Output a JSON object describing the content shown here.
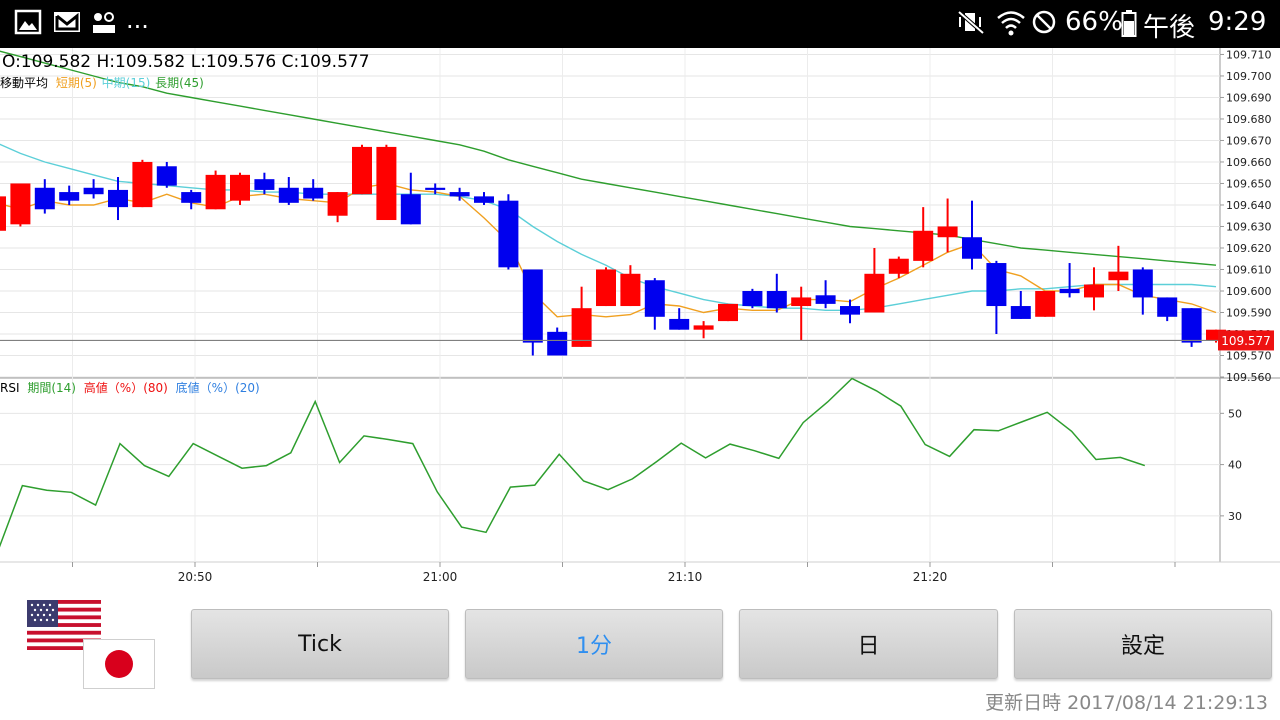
{
  "status_bar": {
    "icons": [
      "gallery-icon",
      "gmail-icon",
      "voicemail-icon",
      "more-notifications-icon",
      "mute-vibrate-icon",
      "wifi-icon",
      "do-not-disturb-icon",
      "battery-icon"
    ],
    "more_label": "...",
    "battery_pct": "66%",
    "ampm": "午後",
    "time": "9:29"
  },
  "chart": {
    "ohlc": {
      "text": "O:109.582 H:109.582 L:109.576 C:109.577"
    },
    "ma_legend": {
      "title": "移動平均",
      "short": "短期(5)",
      "mid": "中期(15)",
      "long": "長期(45)"
    },
    "colors": {
      "up": "#ff0000",
      "down": "#0000ee",
      "short_ma": "#f0a020",
      "mid_ma": "#5ccfd8",
      "long_ma": "#2e9e2e",
      "rsi": "#2e9e2e"
    },
    "current_price_label": "109.577",
    "price_ticks": [
      "109.710",
      "109.700",
      "109.690",
      "109.680",
      "109.670",
      "109.660",
      "109.650",
      "109.640",
      "109.630",
      "109.620",
      "109.610",
      "109.600",
      "109.590",
      "109.580",
      "109.570",
      "109.560"
    ],
    "rsi_legend": {
      "prefix": "RSI",
      "period": "期間(14)",
      "high": "高値（%）(80)",
      "low": "底値（%）(20)"
    },
    "rsi_ticks": [
      "50",
      "40",
      "30"
    ],
    "time_labels": [
      "20:50",
      "21:00",
      "21:10",
      "21:20"
    ]
  },
  "chart_data": {
    "type": "candlestick",
    "price_ylim": [
      109.56,
      109.713
    ],
    "candles": [
      {
        "o": 109.628,
        "h": 109.645,
        "l": 109.626,
        "c": 109.644
      },
      {
        "o": 109.631,
        "h": 109.649,
        "l": 109.63,
        "c": 109.65
      },
      {
        "o": 109.648,
        "h": 109.652,
        "l": 109.636,
        "c": 109.638
      },
      {
        "o": 109.646,
        "h": 109.649,
        "l": 109.64,
        "c": 109.642
      },
      {
        "o": 109.648,
        "h": 109.652,
        "l": 109.643,
        "c": 109.645
      },
      {
        "o": 109.647,
        "h": 109.653,
        "l": 109.633,
        "c": 109.639
      },
      {
        "o": 109.639,
        "h": 109.661,
        "l": 109.639,
        "c": 109.66
      },
      {
        "o": 109.658,
        "h": 109.66,
        "l": 109.648,
        "c": 109.649
      },
      {
        "o": 109.646,
        "h": 109.647,
        "l": 109.638,
        "c": 109.641
      },
      {
        "o": 109.638,
        "h": 109.656,
        "l": 109.638,
        "c": 109.654
      },
      {
        "o": 109.642,
        "h": 109.655,
        "l": 109.64,
        "c": 109.654
      },
      {
        "o": 109.652,
        "h": 109.655,
        "l": 109.645,
        "c": 109.647
      },
      {
        "o": 109.648,
        "h": 109.653,
        "l": 109.64,
        "c": 109.641
      },
      {
        "o": 109.648,
        "h": 109.652,
        "l": 109.642,
        "c": 109.643
      },
      {
        "o": 109.635,
        "h": 109.646,
        "l": 109.632,
        "c": 109.646
      },
      {
        "o": 109.645,
        "h": 109.668,
        "l": 109.645,
        "c": 109.667
      },
      {
        "o": 109.633,
        "h": 109.668,
        "l": 109.633,
        "c": 109.667
      },
      {
        "o": 109.645,
        "h": 109.655,
        "l": 109.631,
        "c": 109.631
      },
      {
        "o": 109.648,
        "h": 109.65,
        "l": 109.645,
        "c": 109.647
      },
      {
        "o": 109.646,
        "h": 109.648,
        "l": 109.642,
        "c": 109.644
      },
      {
        "o": 109.644,
        "h": 109.646,
        "l": 109.64,
        "c": 109.641
      },
      {
        "o": 109.642,
        "h": 109.645,
        "l": 109.61,
        "c": 109.611
      },
      {
        "o": 109.61,
        "h": 109.61,
        "l": 109.57,
        "c": 109.576
      },
      {
        "o": 109.581,
        "h": 109.583,
        "l": 109.57,
        "c": 109.57
      },
      {
        "o": 109.574,
        "h": 109.602,
        "l": 109.574,
        "c": 109.592
      },
      {
        "o": 109.593,
        "h": 109.611,
        "l": 109.593,
        "c": 109.61
      },
      {
        "o": 109.593,
        "h": 109.612,
        "l": 109.593,
        "c": 109.608
      },
      {
        "o": 109.605,
        "h": 109.606,
        "l": 109.582,
        "c": 109.588
      },
      {
        "o": 109.587,
        "h": 109.592,
        "l": 109.582,
        "c": 109.582
      },
      {
        "o": 109.582,
        "h": 109.586,
        "l": 109.578,
        "c": 109.584
      },
      {
        "o": 109.586,
        "h": 109.594,
        "l": 109.586,
        "c": 109.594
      },
      {
        "o": 109.6,
        "h": 109.601,
        "l": 109.592,
        "c": 109.593
      },
      {
        "o": 109.6,
        "h": 109.608,
        "l": 109.59,
        "c": 109.592
      },
      {
        "o": 109.593,
        "h": 109.602,
        "l": 109.577,
        "c": 109.597
      },
      {
        "o": 109.598,
        "h": 109.605,
        "l": 109.592,
        "c": 109.594
      },
      {
        "o": 109.593,
        "h": 109.596,
        "l": 109.585,
        "c": 109.589
      },
      {
        "o": 109.59,
        "h": 109.62,
        "l": 109.59,
        "c": 109.608
      },
      {
        "o": 109.608,
        "h": 109.616,
        "l": 109.606,
        "c": 109.615
      },
      {
        "o": 109.614,
        "h": 109.639,
        "l": 109.611,
        "c": 109.628
      },
      {
        "o": 109.625,
        "h": 109.643,
        "l": 109.618,
        "c": 109.63
      },
      {
        "o": 109.625,
        "h": 109.642,
        "l": 109.61,
        "c": 109.615
      },
      {
        "o": 109.613,
        "h": 109.614,
        "l": 109.58,
        "c": 109.593
      },
      {
        "o": 109.593,
        "h": 109.6,
        "l": 109.587,
        "c": 109.587
      },
      {
        "o": 109.588,
        "h": 109.6,
        "l": 109.588,
        "c": 109.6
      },
      {
        "o": 109.601,
        "h": 109.613,
        "l": 109.597,
        "c": 109.599
      },
      {
        "o": 109.597,
        "h": 109.611,
        "l": 109.591,
        "c": 109.603
      },
      {
        "o": 109.605,
        "h": 109.621,
        "l": 109.6,
        "c": 109.609
      },
      {
        "o": 109.61,
        "h": 109.611,
        "l": 109.589,
        "c": 109.597
      },
      {
        "o": 109.597,
        "h": 109.597,
        "l": 109.586,
        "c": 109.588
      },
      {
        "o": 109.592,
        "h": 109.592,
        "l": 109.574,
        "c": 109.576
      },
      {
        "o": 109.577,
        "h": 109.582,
        "l": 109.576,
        "c": 109.582
      }
    ],
    "ma_short": [
      109.641,
      109.638,
      109.642,
      109.64,
      109.64,
      109.643,
      109.641,
      109.645,
      109.641,
      109.639,
      109.644,
      109.645,
      109.643,
      109.642,
      109.641,
      109.648,
      109.65,
      109.647,
      109.646,
      109.644,
      109.634,
      109.623,
      109.599,
      109.588,
      109.589,
      109.588,
      109.589,
      109.594,
      109.593,
      109.59,
      109.592,
      109.591,
      109.591,
      109.596,
      109.596,
      109.595,
      109.601,
      109.606,
      109.612,
      109.618,
      109.622,
      109.61,
      109.607,
      109.6,
      109.6,
      109.603,
      109.603,
      109.598,
      109.596,
      109.594,
      109.59
    ],
    "ma_mid": [
      109.669,
      109.664,
      109.66,
      109.657,
      109.654,
      109.651,
      109.65,
      109.649,
      109.648,
      109.647,
      109.647,
      109.646,
      109.646,
      109.645,
      109.645,
      109.645,
      109.645,
      109.645,
      109.645,
      109.644,
      109.642,
      109.638,
      109.63,
      109.623,
      109.617,
      109.612,
      109.606,
      109.602,
      109.599,
      109.596,
      109.594,
      109.593,
      109.592,
      109.592,
      109.591,
      109.591,
      109.592,
      109.594,
      109.596,
      109.598,
      109.6,
      109.6,
      109.601,
      109.601,
      109.602,
      109.603,
      109.603,
      109.603,
      109.603,
      109.603,
      109.602
    ],
    "ma_long": [
      109.712,
      109.709,
      109.706,
      109.703,
      109.7,
      109.697,
      109.695,
      109.692,
      109.69,
      109.688,
      109.686,
      109.684,
      109.682,
      109.68,
      109.678,
      109.676,
      109.674,
      109.672,
      109.67,
      109.668,
      109.665,
      109.661,
      109.658,
      109.655,
      109.652,
      109.65,
      109.648,
      109.646,
      109.644,
      109.642,
      109.64,
      109.638,
      109.636,
      109.634,
      109.632,
      109.63,
      109.629,
      109.628,
      109.627,
      109.626,
      109.624,
      109.622,
      109.62,
      109.619,
      109.618,
      109.617,
      109.616,
      109.615,
      109.614,
      109.613,
      109.612
    ],
    "rsi": [
      23.2,
      35.9,
      35.0,
      34.6,
      32.1,
      44.1,
      39.8,
      37.7,
      44.1,
      41.7,
      39.3,
      39.8,
      42.3,
      52.3,
      40.4,
      45.6,
      44.9,
      44.1,
      34.7,
      27.8,
      26.8,
      35.6,
      36.0,
      42.0,
      36.8,
      35.1,
      37.2,
      40.6,
      44.2,
      41.3,
      44.0,
      42.7,
      41.2,
      48.2,
      52.2,
      56.8,
      54.4,
      51.4,
      43.9,
      41.6,
      46.8,
      46.6,
      48.4,
      50.2,
      46.5,
      41.0,
      41.4,
      39.8
    ],
    "rsi_ylim": [
      21,
      56.5
    ],
    "current_price": 109.577,
    "x_labels": [
      "20:50",
      "21:00",
      "21:10",
      "21:20"
    ]
  },
  "bottom": {
    "buttons": [
      {
        "label": "Tick",
        "active": false
      },
      {
        "label": "1分",
        "active": true
      },
      {
        "label": "日",
        "active": false
      },
      {
        "label": "設定",
        "active": false
      }
    ],
    "updated_label": "更新日時",
    "updated_value": "2017/08/14 21:29:13"
  }
}
